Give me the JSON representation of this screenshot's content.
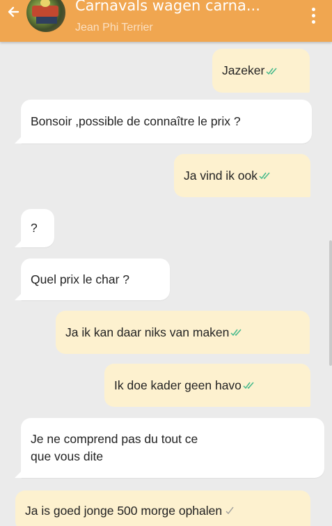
{
  "header": {
    "title": "Carnavals wagen carna...",
    "subtitle": "Jean Phi Terrier"
  },
  "messages": [
    {
      "text": "Jazeker",
      "direction": "outgoing",
      "status": "read"
    },
    {
      "text": "Bonsoir ,possible de connaître le prix ?",
      "direction": "incoming"
    },
    {
      "text": "Ja vind ik ook",
      "direction": "outgoing",
      "status": "read"
    },
    {
      "text": "?",
      "direction": "incoming"
    },
    {
      "text": "Quel prix le char ?",
      "direction": "incoming"
    },
    {
      "text": "Ja ik kan daar niks van maken",
      "direction": "outgoing",
      "status": "read"
    },
    {
      "text": "Ik doe kader geen havo",
      "direction": "outgoing",
      "status": "read"
    },
    {
      "text": "Je ne comprend pas du tout ce que vous dite",
      "direction": "incoming"
    },
    {
      "text": "Ja is goed jonge 500 morge ophalen",
      "direction": "outgoing",
      "status": "sent"
    }
  ],
  "colors": {
    "header": "#f0a650",
    "outgoing_bubble": "#fdf1cf",
    "incoming_bubble": "#ffffff",
    "read_tick": "#43b98a",
    "sent_tick": "#9a9a9a",
    "background": "#ebebeb"
  },
  "icons": [
    "back-arrow-icon",
    "avatar",
    "overflow-menu-icon",
    "double-check-icon",
    "single-check-icon"
  ]
}
